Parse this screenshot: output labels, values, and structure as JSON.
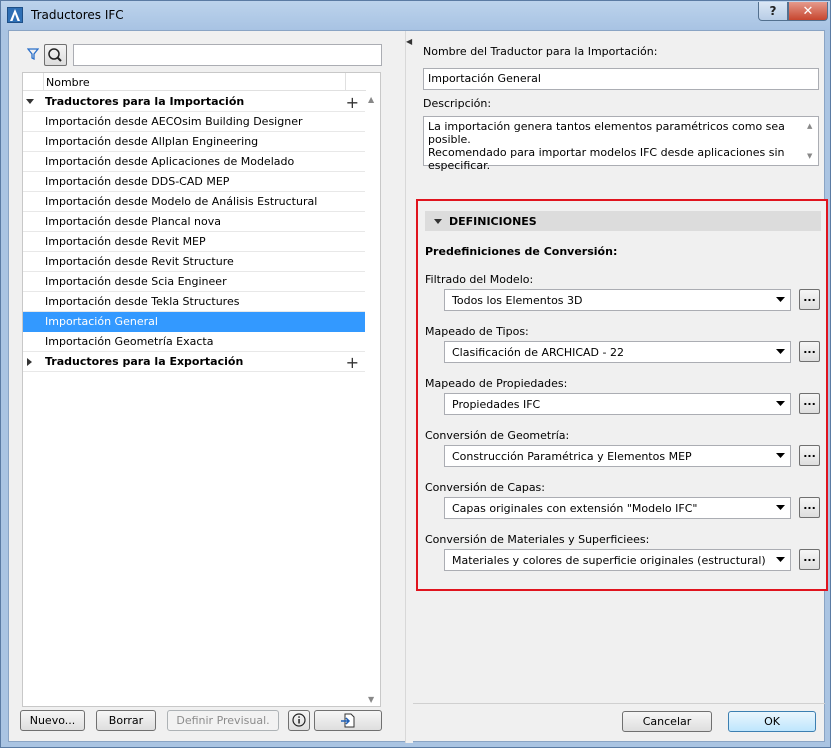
{
  "window": {
    "title": "Traductores IFC",
    "help": "?",
    "close": "✕"
  },
  "left": {
    "search_placeholder": "",
    "column_header": "Nombre",
    "groups": [
      {
        "label": "Traductores para la Importación",
        "expanded": true,
        "items": [
          "Importación desde AECOsim Building Designer",
          "Importación desde Allplan Engineering",
          "Importación desde Aplicaciones de Modelado",
          "Importación desde DDS-CAD MEP",
          "Importación desde Modelo de Análisis Estructural",
          "Importación desde Plancal nova",
          "Importación desde Revit MEP",
          "Importación desde Revit Structure",
          "Importación desde Scia Engineer",
          "Importación desde Tekla Structures",
          "Importación General",
          "Importación Geometría Exacta"
        ],
        "selected_index": 10
      },
      {
        "label": "Traductores para la Exportación",
        "expanded": false,
        "items": []
      }
    ],
    "buttons": {
      "new": "Nuevo...",
      "delete": "Borrar",
      "set_default": "Definir Previsual.",
      "info": "i"
    }
  },
  "right": {
    "name_label": "Nombre del Traductor para la Importación:",
    "name_value": "Importación General",
    "desc_label": "Descripción:",
    "desc_lines": [
      "La importación genera tantos elementos paramétricos como sea posible.",
      "Recomendado para importar modelos IFC desde aplicaciones sin",
      "especificar."
    ],
    "section": {
      "title": "DEFINICIONES",
      "subtitle": "Predefiniciones de Conversión:",
      "settings": [
        {
          "label": "Filtrado del Modelo:",
          "value": "Todos los Elementos 3D"
        },
        {
          "label": "Mapeado de Tipos:",
          "value": "Clasificación de ARCHICAD - 22"
        },
        {
          "label": "Mapeado de Propiedades:",
          "value": "Propiedades IFC"
        },
        {
          "label": "Conversión de Geometría:",
          "value": "Construcción Paramétrica y Elementos MEP"
        },
        {
          "label": "Conversión de Capas:",
          "value": "Capas originales con extensión \"Modelo IFC\""
        },
        {
          "label": "Conversión de Materiales y Superficiees:",
          "value": "Materiales y colores de superficie originales (estructural)"
        }
      ],
      "dots": "..."
    },
    "cancel": "Cancelar",
    "ok": "OK"
  },
  "colors": {
    "selection": "#3399ff",
    "highlight_border": "#e0141e"
  }
}
